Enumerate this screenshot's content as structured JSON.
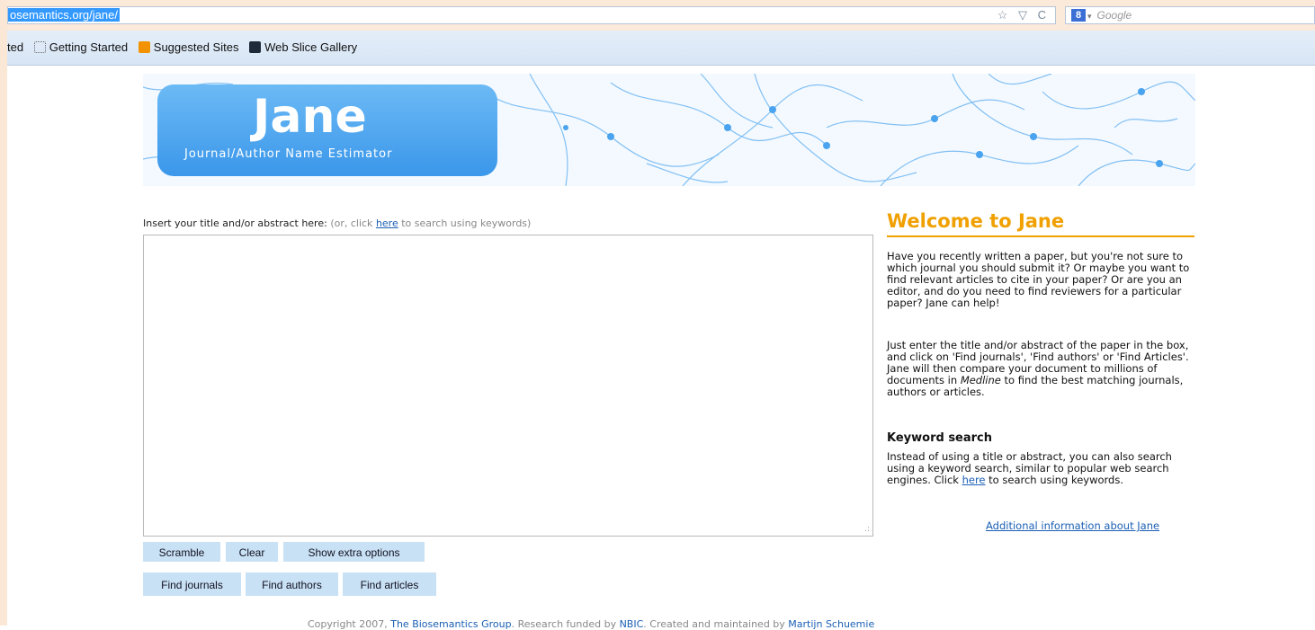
{
  "browser": {
    "url": "osemantics.org/jane/",
    "search_placeholder": "Google",
    "url_icons": "☆ ▽ C",
    "search_engine_icon": "8"
  },
  "bookmarks": {
    "truncated_label": "ted",
    "items": [
      "Getting Started",
      "Suggested Sites",
      "Web Slice Gallery"
    ]
  },
  "banner": {
    "logo_title": "Jane",
    "logo_subtitle": "Journal/Author Name Estimator"
  },
  "input": {
    "label": "Insert your title and/or abstract here:",
    "hint_prefix": "(or, click ",
    "hint_link": "here",
    "hint_suffix": " to search using keywords)"
  },
  "buttons": {
    "scramble": "Scramble",
    "clear": "Clear",
    "extra_options": "Show extra options",
    "find_journals": "Find journals",
    "find_authors": "Find authors",
    "find_articles": "Find articles"
  },
  "sidebar": {
    "title": "Welcome to Jane",
    "intro": "Have you recently written a paper, but you're not sure to which journal you should submit it? Or maybe you want to find relevant articles to cite in your paper? Or are you an editor, and do you need to find reviewers for a particular paper? Jane can help!",
    "instructions_before": "Just enter the title and/or abstract of the paper in the box, and click on 'Find journals', 'Find authors' or 'Find Articles'. Jane will then compare your document to millions of documents in ",
    "instructions_em": "Medline",
    "instructions_after": " to find the best matching journals, authors or articles.",
    "keyword_heading": "Keyword search",
    "keyword_before": "Instead of using a title or abstract, you can also search using a keyword search, similar to popular web search engines. Click ",
    "keyword_link": "here",
    "keyword_after": " to search using keywords.",
    "more_info_link": "Additional information about Jane"
  },
  "footer": {
    "prefix": "Copyright 2007, ",
    "group_link": "The Biosemantics Group",
    "middle": ". Research funded by ",
    "funder_link": "NBIC",
    "middle2": ". Created and maintained by ",
    "author_link": "Martijn Schuemie"
  }
}
